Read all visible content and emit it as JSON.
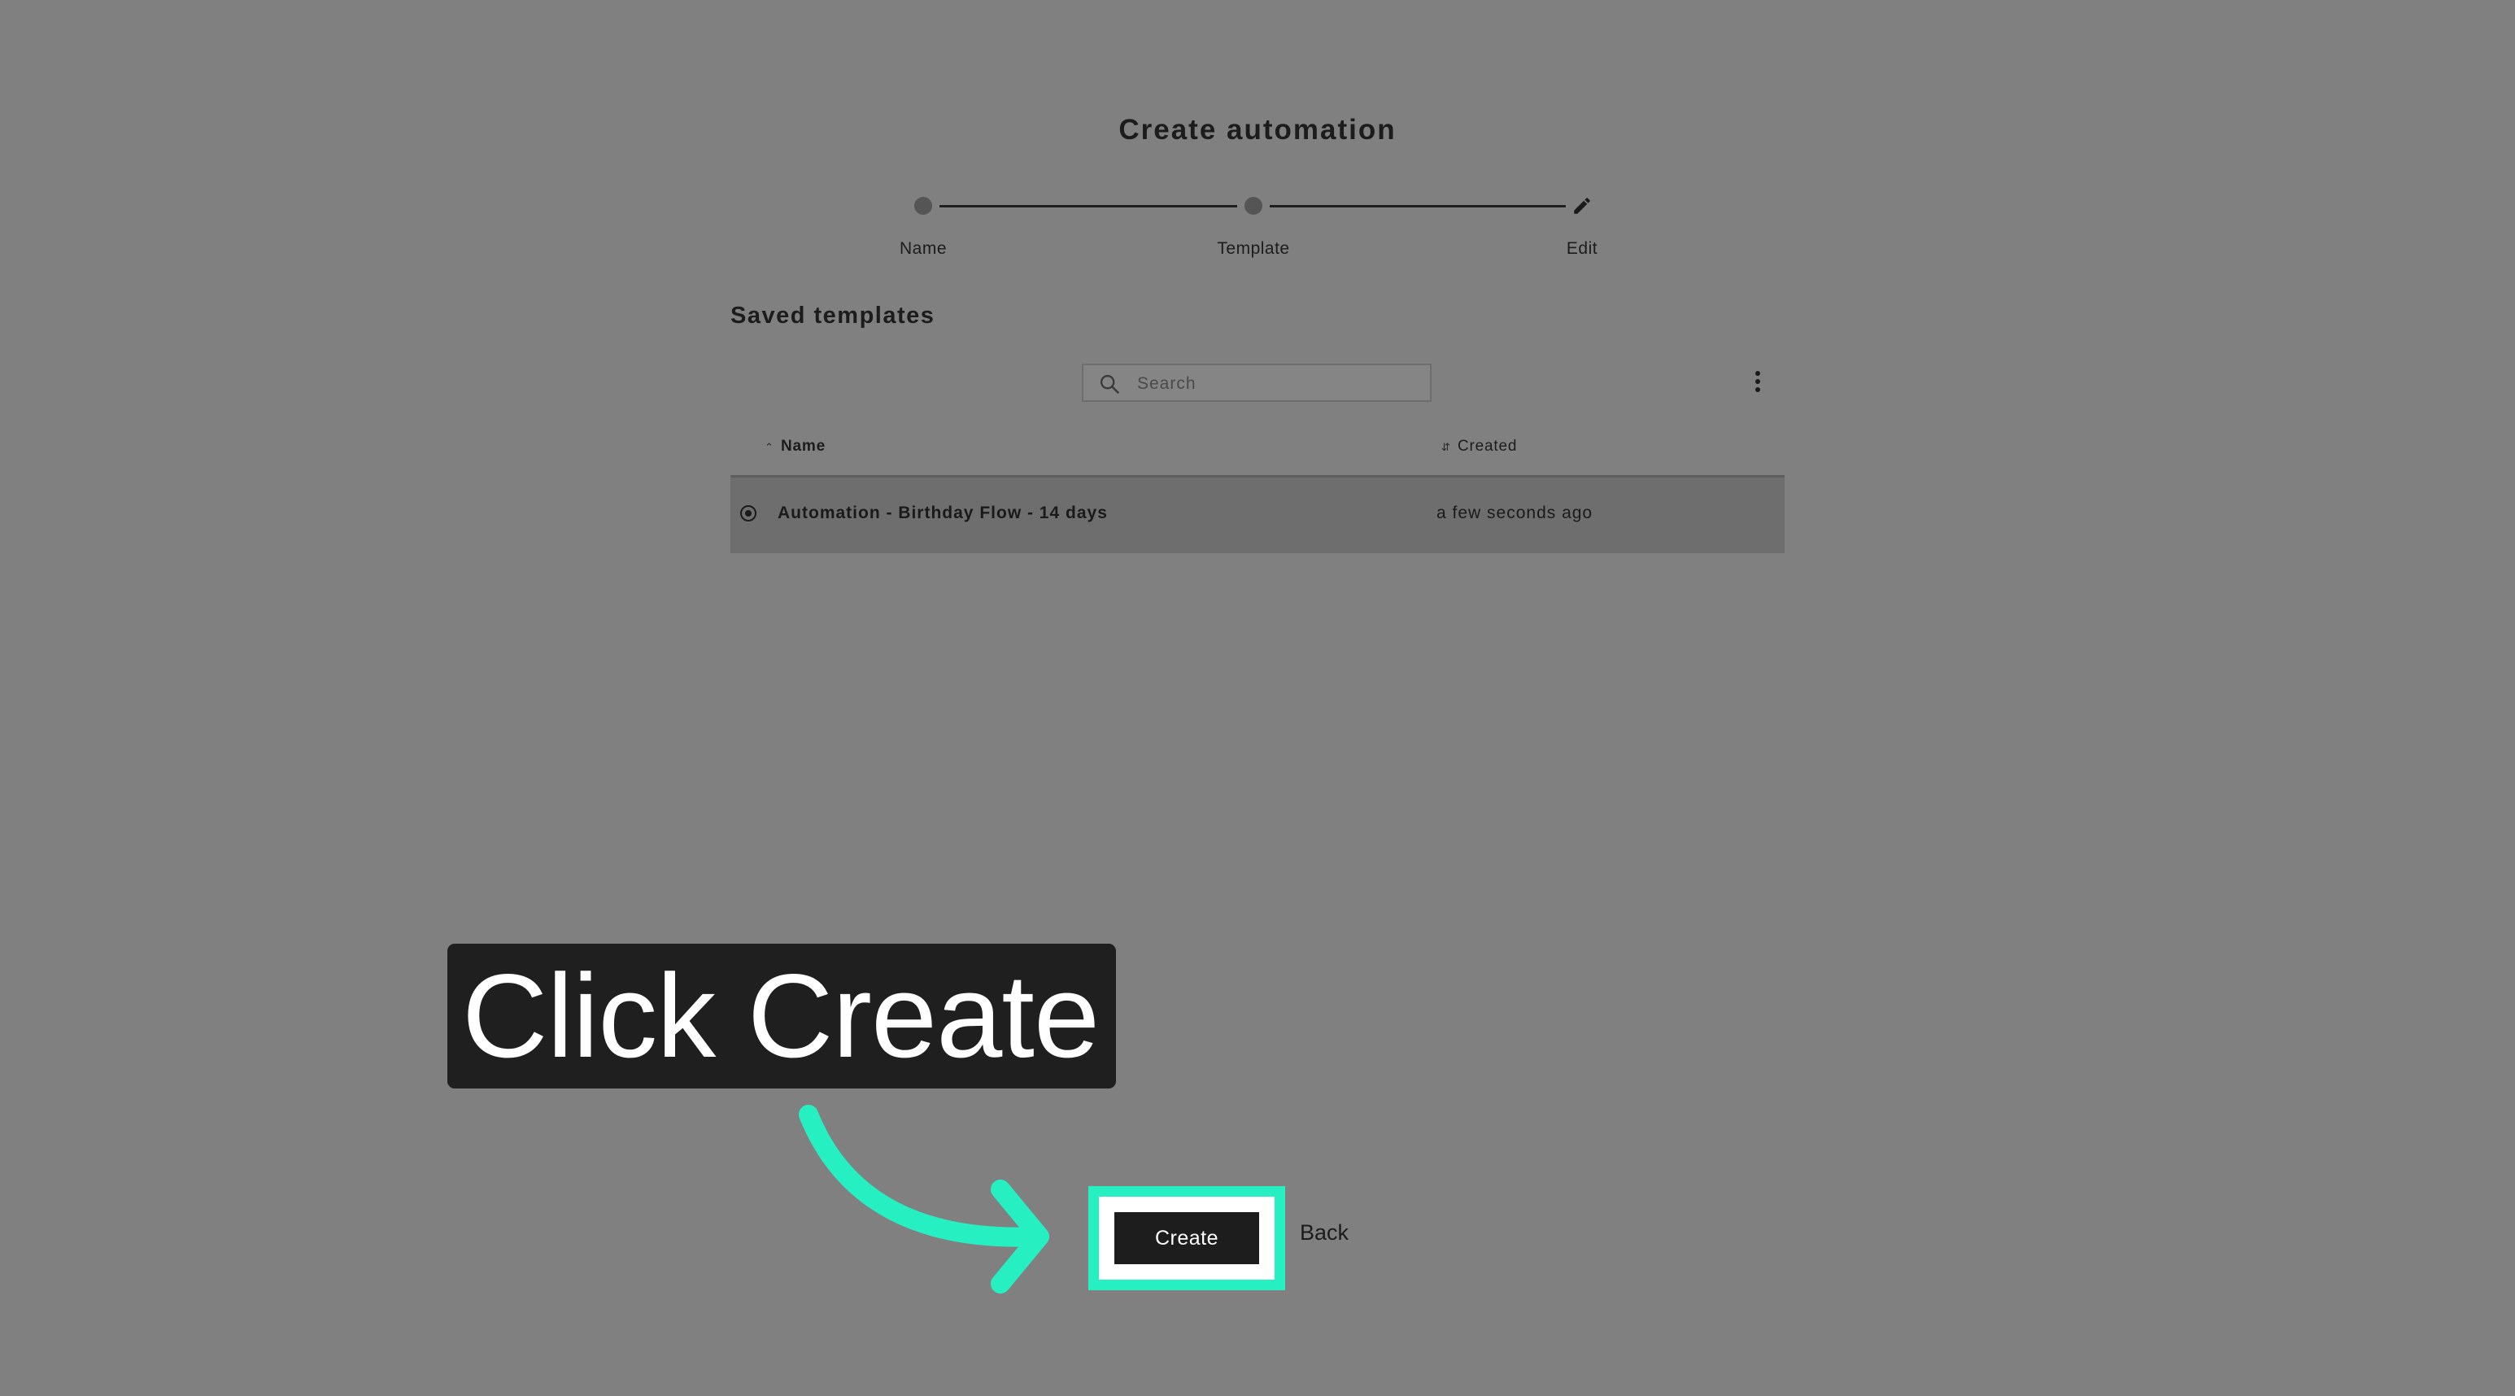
{
  "page": {
    "title": "Create automation"
  },
  "stepper": {
    "steps": [
      {
        "label": "Name",
        "state": "done"
      },
      {
        "label": "Template",
        "state": "done"
      },
      {
        "label": "Edit",
        "state": "current",
        "icon": "pencil-icon"
      }
    ]
  },
  "templates": {
    "section_title": "Saved templates",
    "search": {
      "placeholder": "Search",
      "value": ""
    },
    "columns": [
      {
        "label": "Name",
        "sort": "ascending"
      },
      {
        "label": "Created",
        "sort": "none"
      }
    ],
    "rows": [
      {
        "name": "Automation - Birthday Flow - 14 days",
        "created": "a few seconds ago",
        "selected": true
      }
    ]
  },
  "actions": {
    "create_label": "Create",
    "back_label": "Back"
  },
  "tutorial": {
    "callout_text": "Click Create",
    "accent_color": "#26f0c2"
  }
}
